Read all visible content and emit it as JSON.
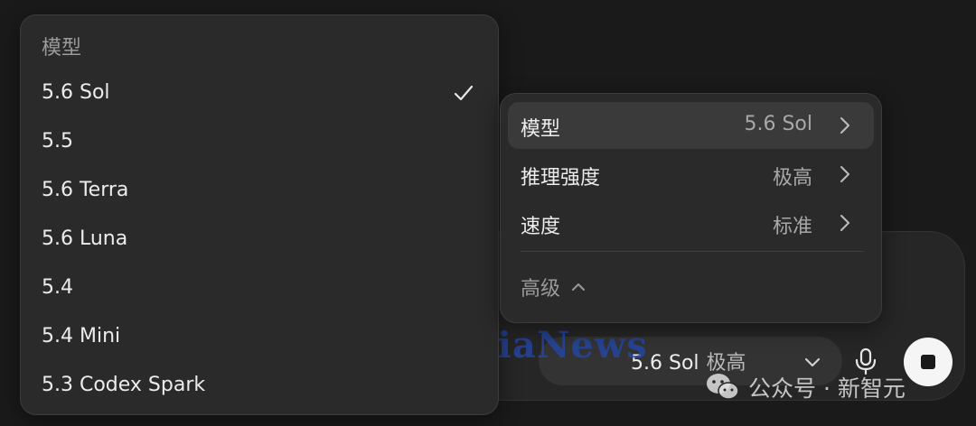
{
  "model_menu": {
    "heading": "模型",
    "options": [
      {
        "label": "5.6 Sol",
        "selected": true
      },
      {
        "label": "5.5",
        "selected": false
      },
      {
        "label": "5.6 Terra",
        "selected": false
      },
      {
        "label": "5.6 Luna",
        "selected": false
      },
      {
        "label": "5.4",
        "selected": false
      },
      {
        "label": "5.4 Mini",
        "selected": false
      },
      {
        "label": "5.3 Codex Spark",
        "selected": false
      }
    ]
  },
  "settings_menu": {
    "rows": [
      {
        "label": "模型",
        "value": "5.6 Sol",
        "highlighted": true
      },
      {
        "label": "推理强度",
        "value": "极高",
        "highlighted": false
      },
      {
        "label": "速度",
        "value": "标准",
        "highlighted": false
      }
    ],
    "advanced_label": "高级"
  },
  "composer": {
    "model_pill": {
      "model": "5.6 Sol",
      "effort": "极高"
    }
  },
  "watermarks": {
    "bianews": "鞭牛士 BiaNews",
    "wechat": "公众号 · 新智元"
  },
  "icons": {
    "check": "checkmark-icon",
    "chevron_right": "chevron-right-icon",
    "chevron_up": "chevron-up-icon",
    "chevron_down": "chevron-down-icon",
    "microphone": "microphone-icon",
    "stop": "stop-icon",
    "wechat": "wechat-icon"
  },
  "colors": {
    "background": "#1a1a1a",
    "menu_surface": "#2a2a2a",
    "highlight_row": "#3a3a3a",
    "text_primary": "#ececec",
    "text_secondary": "#a8a8a8",
    "watermark_blue": "#2448aa"
  }
}
